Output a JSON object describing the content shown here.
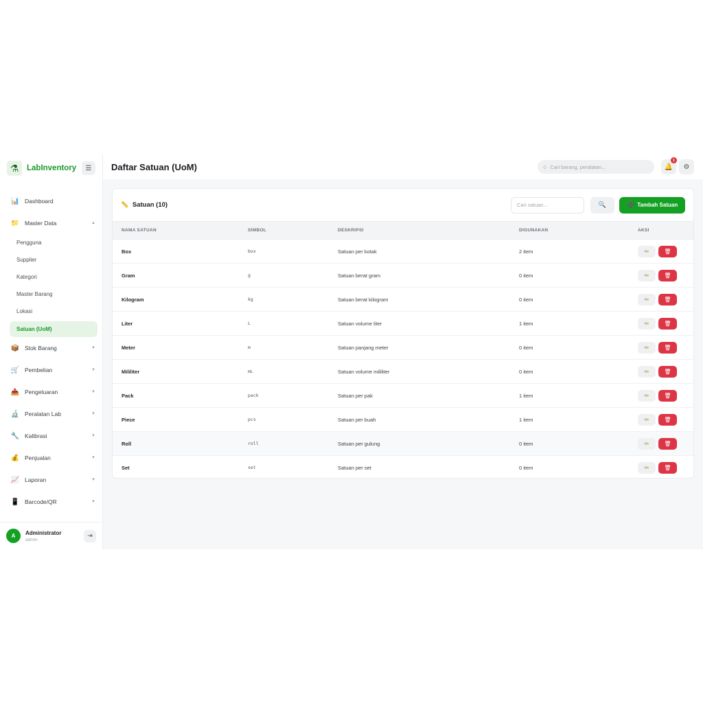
{
  "brand": {
    "name": "LabInventory",
    "logo_icon": "microscope-icon"
  },
  "sidebar": {
    "items": [
      {
        "label": "Dashboard",
        "icon": "📊",
        "has_chevron": false
      },
      {
        "label": "Master Data",
        "icon": "📁",
        "has_chevron": true,
        "expanded": true
      }
    ],
    "master_data_children": [
      "Pengguna",
      "Supplier",
      "Kategori",
      "Master Barang",
      "Lokasi",
      "Satuan (UoM)"
    ],
    "active_child": "Satuan (UoM)",
    "more_items": [
      {
        "label": "Stok Barang",
        "icon": "📦"
      },
      {
        "label": "Pembelian",
        "icon": "🛒"
      },
      {
        "label": "Pengeluaran",
        "icon": "📤"
      },
      {
        "label": "Peralatan Lab",
        "icon": "🔬"
      },
      {
        "label": "Kalibrasi",
        "icon": "🔧"
      },
      {
        "label": "Penjualan",
        "icon": "💰"
      },
      {
        "label": "Laporan",
        "icon": "📈"
      },
      {
        "label": "Barcode/QR",
        "icon": "📱"
      }
    ]
  },
  "user": {
    "initial": "A",
    "name": "Administrator",
    "role": "admin"
  },
  "header": {
    "title": "Daftar Satuan (UoM)",
    "search_placeholder": "Cari barang, peralatan...",
    "notification_count": "1"
  },
  "card": {
    "title": "Satuan (10)",
    "search_placeholder": "Cari satuan...",
    "add_label": "Tambah Satuan"
  },
  "table": {
    "columns": [
      "NAMA SATUAN",
      "SIMBOL",
      "DESKRIPSI",
      "DIGUNAKAN",
      "AKSI"
    ],
    "rows": [
      {
        "name": "Box",
        "symbol": "box",
        "description": "Satuan per kotak",
        "used": "2 item"
      },
      {
        "name": "Gram",
        "symbol": "g",
        "description": "Satuan berat gram",
        "used": "0 item"
      },
      {
        "name": "Kilogram",
        "symbol": "kg",
        "description": "Satuan berat kilogram",
        "used": "0 item"
      },
      {
        "name": "Liter",
        "symbol": "L",
        "description": "Satuan volume liter",
        "used": "1 item"
      },
      {
        "name": "Meter",
        "symbol": "m",
        "description": "Satuan panjang meter",
        "used": "0 item"
      },
      {
        "name": "Mililiter",
        "symbol": "mL",
        "description": "Satuan volume mililiter",
        "used": "0 item"
      },
      {
        "name": "Pack",
        "symbol": "pack",
        "description": "Satuan per pak",
        "used": "1 item"
      },
      {
        "name": "Piece",
        "symbol": "pcs",
        "description": "Satuan per buah",
        "used": "1 item"
      },
      {
        "name": "Roll",
        "symbol": "roll",
        "description": "Satuan per gulung",
        "used": "0 item"
      },
      {
        "name": "Set",
        "symbol": "set",
        "description": "Satuan per set",
        "used": "0 item"
      }
    ]
  },
  "colors": {
    "accent": "#13a023",
    "danger": "#dc3545",
    "active_bg": "#e6f4e6"
  }
}
